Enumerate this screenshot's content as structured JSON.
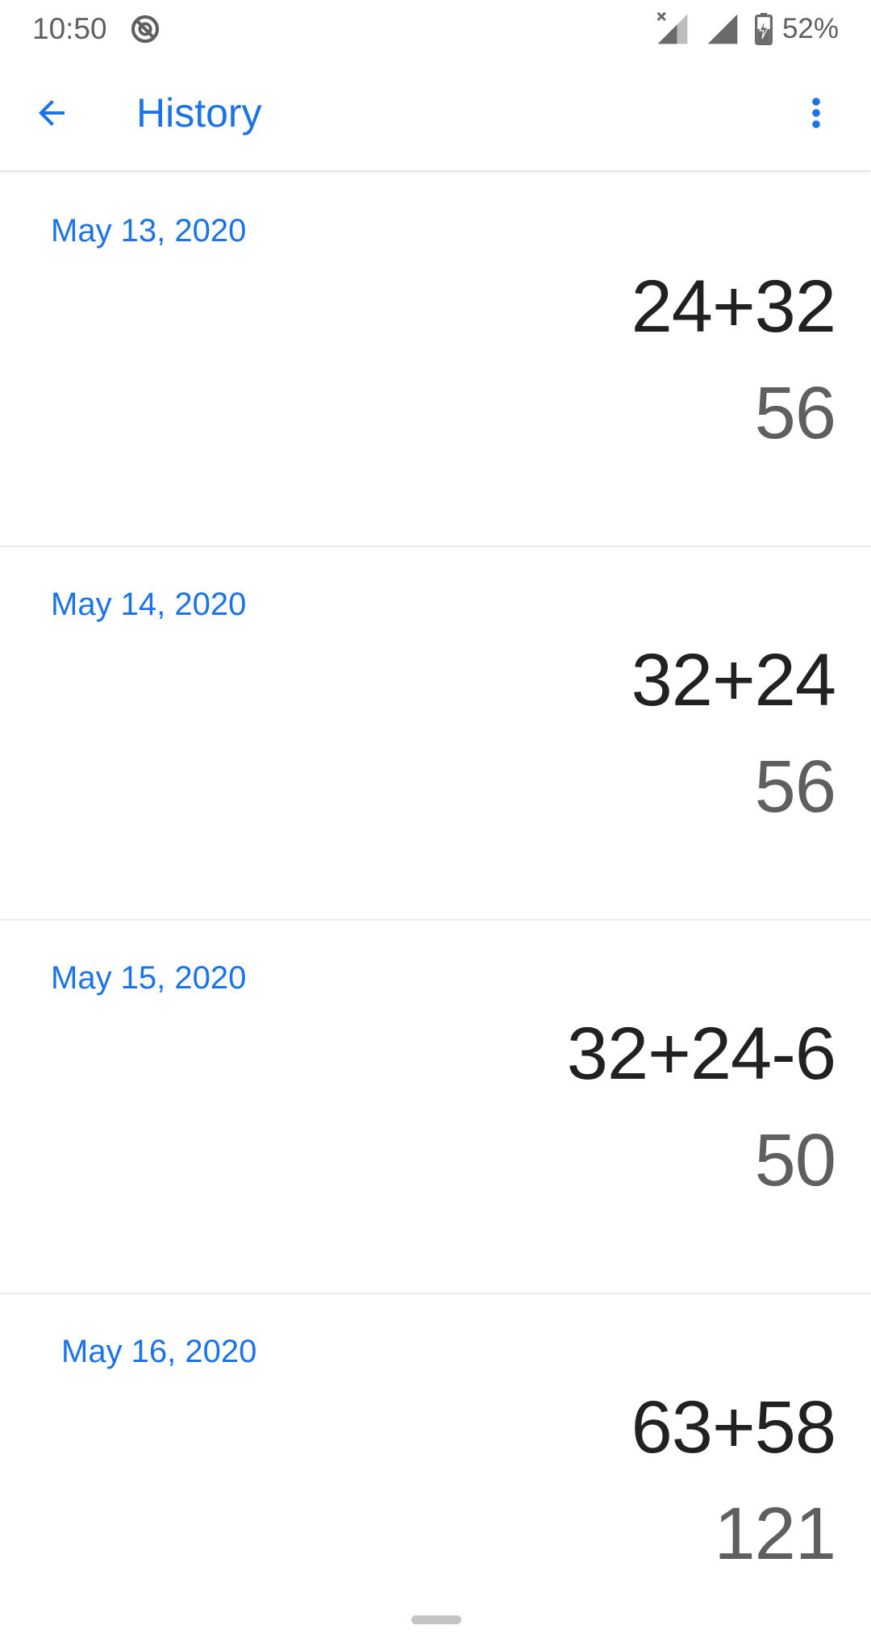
{
  "status_bar": {
    "time": "10:50",
    "battery_percent": "52%",
    "icons": [
      "do-not-disturb-icon",
      "signal-no-data-icon",
      "signal-icon",
      "battery-charging-icon"
    ]
  },
  "app_bar": {
    "title": "History",
    "back_icon": "arrow-back-icon",
    "more_icon": "more-vert-icon"
  },
  "history": [
    {
      "date": "May 13, 2020",
      "expression": "24+32",
      "result": "56"
    },
    {
      "date": "May 14, 2020",
      "expression": "32+24",
      "result": "56"
    },
    {
      "date": "May 15, 2020",
      "expression": "32+24-6",
      "result": "50"
    },
    {
      "date": "May 16, 2020",
      "expression": "63+58",
      "result": "121"
    }
  ],
  "colors": {
    "accent": "#1a73e8",
    "expression_text": "#212121",
    "result_text": "#5f5f5f",
    "divider": "#ececec"
  }
}
